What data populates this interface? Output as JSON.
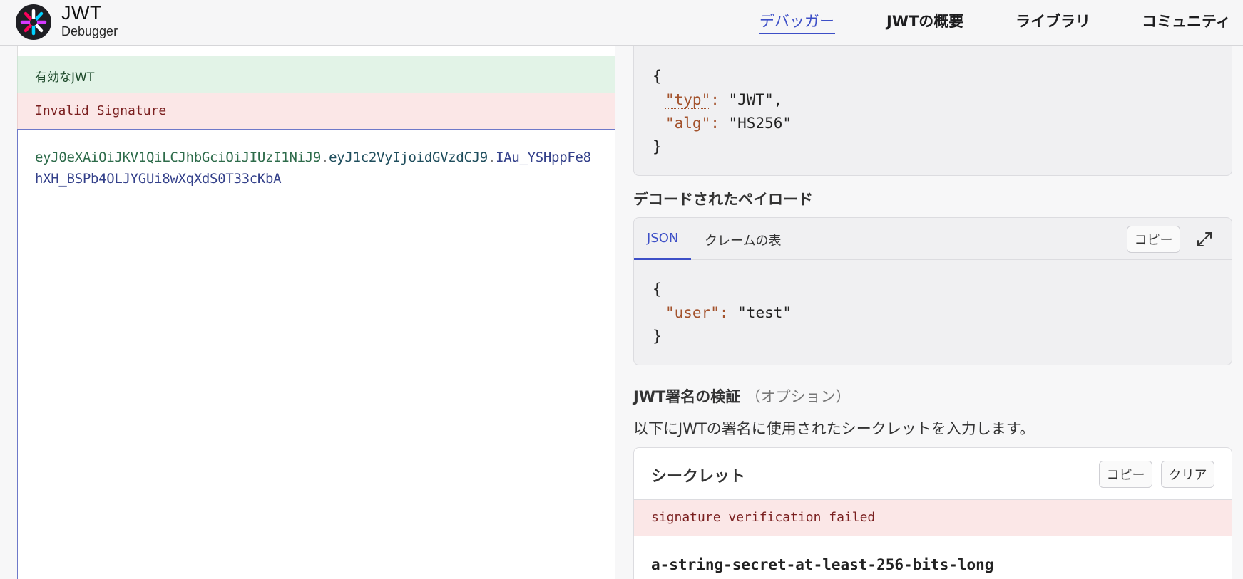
{
  "header": {
    "brand_title": "JWT",
    "brand_subtitle": "Debugger",
    "logo_icon": "jwt-logo-icon",
    "nav": [
      {
        "label": "デバッガー",
        "active": true
      },
      {
        "label": "JWTの概要",
        "active": false
      },
      {
        "label": "ライブラリ",
        "active": false
      },
      {
        "label": "コミュニティ",
        "active": false
      }
    ]
  },
  "encoded": {
    "status_valid": "有効なJWT",
    "status_invalid": "Invalid Signature",
    "token_header": "eyJ0eXAiOiJKV1QiLCJhbGciOiJIUzI1NiJ9",
    "token_payload": "eyJ1c2VyIjoidGVzdCJ9",
    "token_signature": "IAu_YSHppFe8hXH_BSPb4OLJYGUi8wXqXdS0T33cKbA",
    "dot": "."
  },
  "decoded_header": {
    "open": "{",
    "close": "}",
    "fields": [
      {
        "key": "\"typ\"",
        "value": "\"JWT\","
      },
      {
        "key": "\"alg\"",
        "value": "\"HS256\""
      }
    ]
  },
  "decoded_payload": {
    "title": "デコードされたペイロード",
    "tabs": [
      "JSON",
      "クレームの表"
    ],
    "copy_label": "コピー",
    "expand_icon": "expand-icon",
    "open": "{",
    "close": "}",
    "fields": [
      {
        "key": "\"user\"",
        "value": "\"test\""
      }
    ]
  },
  "verify": {
    "title": "JWT署名の検証",
    "title_optional": "（オプション）",
    "description": "以下にJWTの署名に使用されたシークレットを入力します。",
    "secret_title": "シークレット",
    "copy_label": "コピー",
    "clear_label": "クリア",
    "error": "signature verification failed",
    "secret_value": "a-string-secret-at-least-256-bits-long"
  },
  "colors": {
    "accent": "#3d4fc7",
    "valid_bg": "#e2f3e7",
    "invalid_bg": "#fbe7e7",
    "json_key": "#a3522c"
  }
}
